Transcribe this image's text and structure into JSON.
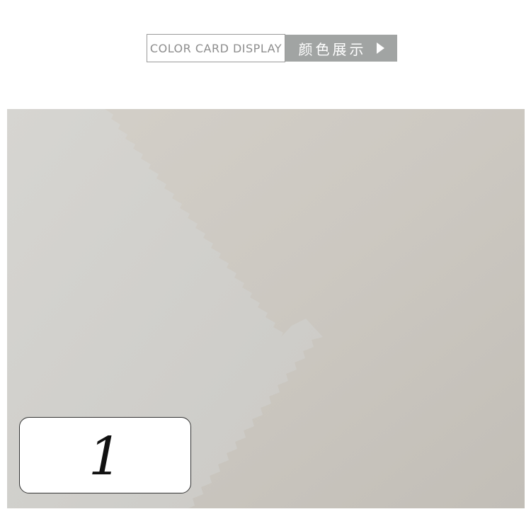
{
  "header": {
    "english_label": "COLOR CARD DISPLAY",
    "chinese_label": "颜色展示",
    "arrow_icon": "play-arrow-icon",
    "accent_color": "#a1a4a3"
  },
  "swatch": {
    "number": "1",
    "fabric_color": "#cdc9c2",
    "swatch_color": "#d2d1cd"
  }
}
